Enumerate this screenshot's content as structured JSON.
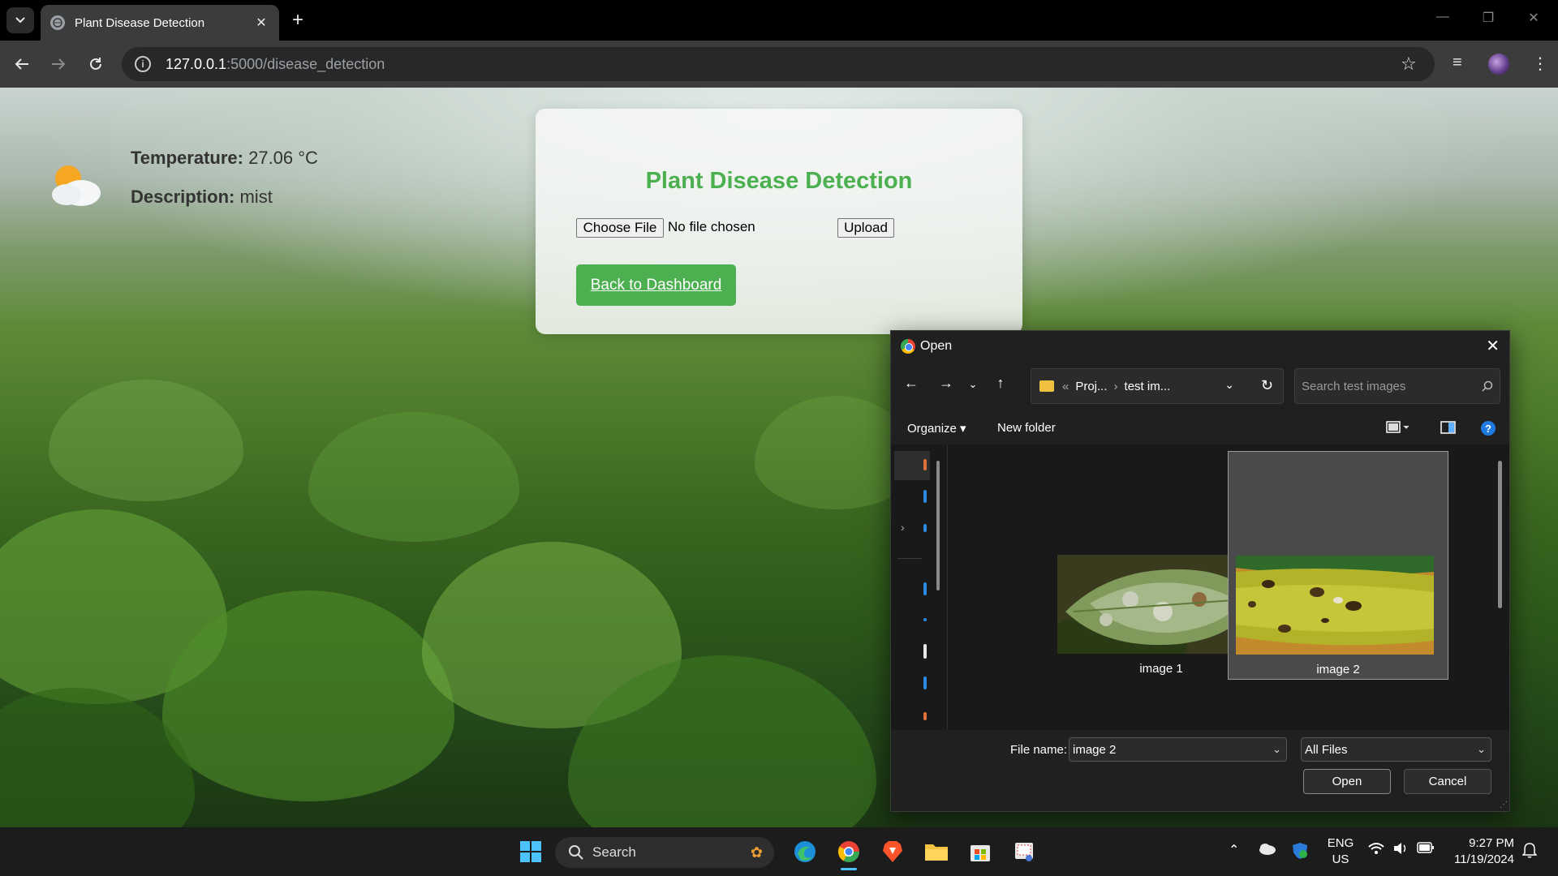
{
  "browser": {
    "tab_title": "Plant Disease Detection",
    "url_host": "127.0.0.1",
    "url_path": ":5000/disease_detection"
  },
  "weather": {
    "temp_label": "Temperature:",
    "temp_value": "27.06 °C",
    "desc_label": "Description:",
    "desc_value": "mist"
  },
  "card": {
    "title": "Plant Disease Detection",
    "choose_file": "Choose File",
    "no_file": "No file chosen",
    "upload": "Upload",
    "back": "Back to Dashboard"
  },
  "dialog": {
    "title": "Open",
    "path": [
      "Proj...",
      "test im..."
    ],
    "search_placeholder": "Search test images",
    "organize": "Organize",
    "new_folder": "New folder",
    "files": [
      {
        "name": "image 1",
        "selected": false
      },
      {
        "name": "image 2",
        "selected": true
      }
    ],
    "file_name_label": "File name:",
    "file_name_value": "image 2",
    "file_type": "All Files",
    "open": "Open",
    "cancel": "Cancel"
  },
  "taskbar": {
    "search": "Search",
    "lang_top": "ENG",
    "lang_bottom": "US",
    "time": "9:27 PM",
    "date": "11/19/2024"
  },
  "colors": {
    "accent_green": "#4caf50",
    "dialog_bg": "#202020",
    "taskbar_bg": "#1c1c1c"
  }
}
